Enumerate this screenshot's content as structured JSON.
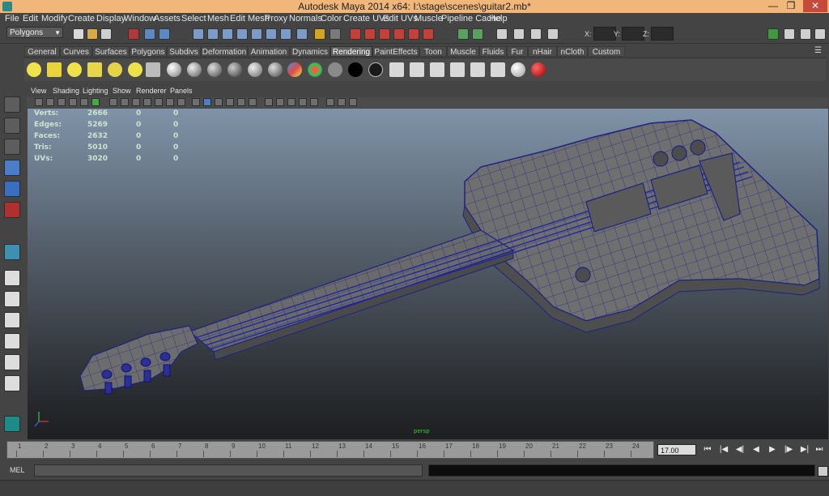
{
  "window": {
    "title": "Autodesk Maya 2014 x64: I:\\stage\\scenes\\guitar2.mb*",
    "minimize": "—",
    "restore": "❐",
    "close": "✕"
  },
  "menubar": [
    "File",
    "Edit",
    "Modify",
    "Create",
    "Display",
    "Window",
    "Assets",
    "Select",
    "Mesh",
    "Edit Mesh",
    "Proxy",
    "Normals",
    "Color",
    "Create UVs",
    "Edit UVs",
    "Muscle",
    "Pipeline Cache",
    "Help"
  ],
  "statusline": {
    "menu_set": "Polygons",
    "x_label": "X:",
    "y_label": "Y:",
    "z_label": "Z:"
  },
  "shelf_tabs": [
    "General",
    "Curves",
    "Surfaces",
    "Polygons",
    "Subdivs",
    "Deformation",
    "Animation",
    "Dynamics",
    "Rendering",
    "PaintEffects",
    "Toon",
    "Muscle",
    "Fluids",
    "Fur",
    "nHair",
    "nCloth",
    "Custom"
  ],
  "active_shelf_tab": "Rendering",
  "viewport": {
    "menu": [
      "View",
      "Shading",
      "Lighting",
      "Show",
      "Renderer",
      "Panels"
    ],
    "hud": {
      "rows": [
        {
          "label": "Verts:",
          "a": "2666",
          "b": "0",
          "c": "0"
        },
        {
          "label": "Edges:",
          "a": "5269",
          "b": "0",
          "c": "0"
        },
        {
          "label": "Faces:",
          "a": "2632",
          "b": "0",
          "c": "0"
        },
        {
          "label": "Tris:",
          "a": "5010",
          "b": "0",
          "c": "0"
        },
        {
          "label": "UVs:",
          "a": "3020",
          "b": "0",
          "c": "0"
        }
      ],
      "camera": "persp"
    }
  },
  "timeslider": {
    "ticks": [
      "1",
      "2",
      "3",
      "4",
      "5",
      "6",
      "7",
      "8",
      "9",
      "10",
      "11",
      "12",
      "13",
      "14",
      "15",
      "16",
      "17",
      "18",
      "19",
      "20",
      "21",
      "22",
      "23",
      "24"
    ],
    "current_frame": "17.00",
    "buttons": [
      "⏮",
      "|◀",
      "◀|",
      "◀",
      "▶",
      "|▶",
      "▶|",
      "⏭"
    ]
  },
  "melbar": {
    "label": "MEL"
  },
  "colors": {
    "title_bar": "#f0b67a",
    "ui_gray": "#444444",
    "wire_blue": "#1a1a8c",
    "mesh_gray": "#6e6e6e"
  }
}
